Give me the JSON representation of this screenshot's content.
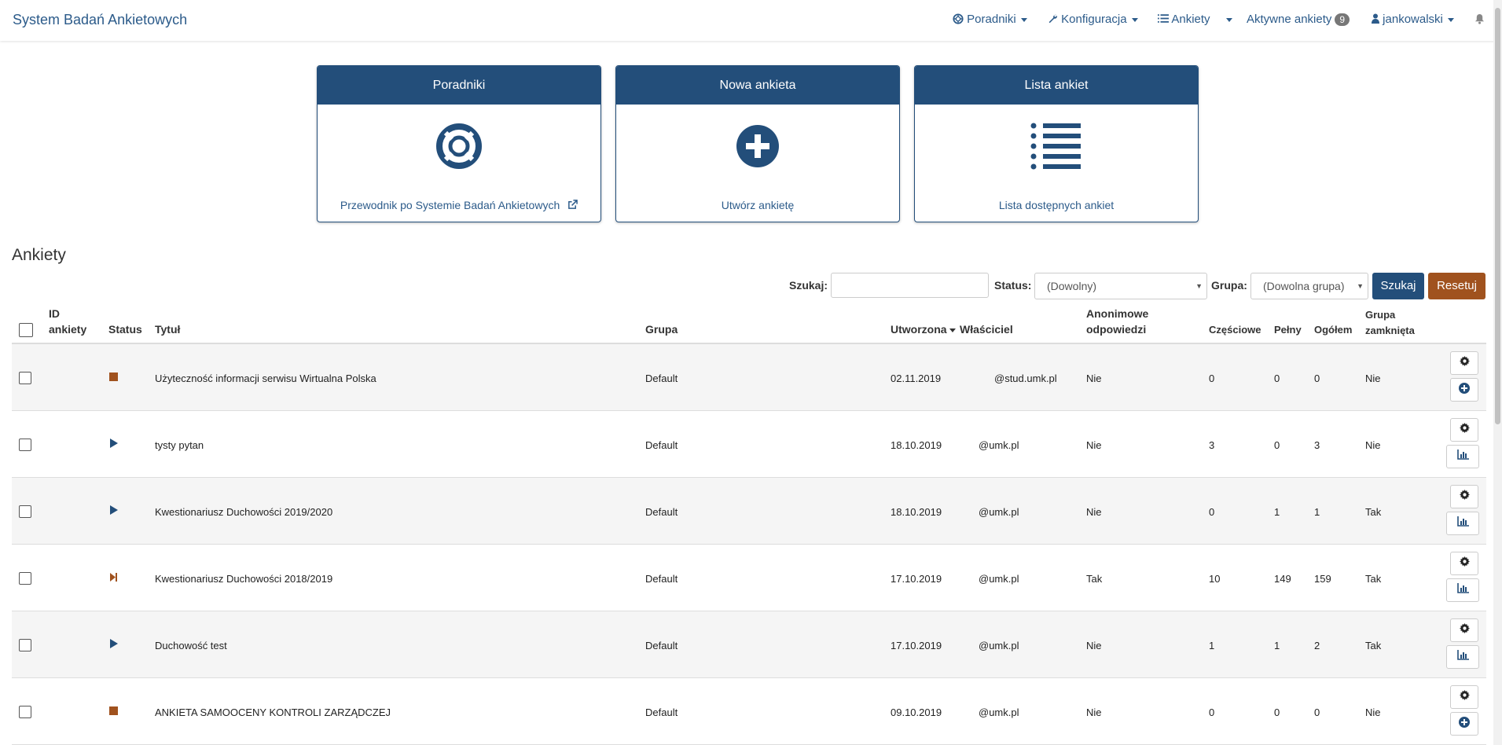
{
  "navbar": {
    "brand": "System Badań Ankietowych",
    "items": {
      "poradniki": "Poradniki",
      "konfiguracja": "Konfiguracja",
      "ankiety": "Ankiety",
      "aktywne": "Aktywne ankiety",
      "aktywne_count": "9",
      "user": "jankowalski"
    }
  },
  "cards": [
    {
      "title": "Poradniki",
      "icon": "lifebuoy-icon",
      "link": "Przewodnik po Systemie Badań Ankietowych"
    },
    {
      "title": "Nowa ankieta",
      "icon": "plus-circle-icon",
      "link": "Utwórz ankietę"
    },
    {
      "title": "Lista ankiet",
      "icon": "list-icon",
      "link": "Lista dostępnych ankiet"
    }
  ],
  "section_title": "Ankiety",
  "filters": {
    "search_label": "Szukaj:",
    "search_value": "",
    "status_label": "Status:",
    "status_value": "(Dowolny)",
    "group_label": "Grupa:",
    "group_value": "(Dowolna grupa)",
    "search_button": "Szukaj",
    "reset_button": "Resetuj"
  },
  "table": {
    "headers": {
      "id_line1": "ID",
      "id_line2": "ankiety",
      "status": "Status",
      "title": "Tytuł",
      "group": "Grupa",
      "created": "Utworzona",
      "owner": "Właściciel",
      "anon_line1": "Anonimowe",
      "anon_line2": "odpowiedzi",
      "partial": "Częściowe",
      "full": "Pełny",
      "total": "Ogółem",
      "closed_line1": "Grupa",
      "closed_line2": "zamknięta"
    },
    "rows": [
      {
        "status": "stopped",
        "title": "Użyteczność informacji serwisu Wirtualna Polska",
        "group": "Default",
        "created": "02.11.2019",
        "owner": "@stud.umk.pl",
        "anon": "Nie",
        "partial": "0",
        "full": "0",
        "total": "0",
        "closed": "Nie",
        "action": "add"
      },
      {
        "status": "active",
        "title": "tysty pytan",
        "group": "Default",
        "created": "18.10.2019",
        "owner": "@umk.pl",
        "anon": "Nie",
        "partial": "3",
        "full": "0",
        "total": "3",
        "closed": "Nie",
        "action": "stats"
      },
      {
        "status": "active",
        "title": "Kwestionariusz Duchowości 2019/2020",
        "group": "Default",
        "created": "18.10.2019",
        "owner": "@umk.pl",
        "anon": "Nie",
        "partial": "0",
        "full": "1",
        "total": "1",
        "closed": "Tak",
        "action": "stats"
      },
      {
        "status": "expired",
        "title": "Kwestionariusz Duchowości 2018/2019",
        "group": "Default",
        "created": "17.10.2019",
        "owner": "@umk.pl",
        "anon": "Tak",
        "partial": "10",
        "full": "149",
        "total": "159",
        "closed": "Tak",
        "action": "stats"
      },
      {
        "status": "active",
        "title": "Duchowość test",
        "group": "Default",
        "created": "17.10.2019",
        "owner": "@umk.pl",
        "anon": "Nie",
        "partial": "1",
        "full": "1",
        "total": "2",
        "closed": "Tak",
        "action": "stats"
      },
      {
        "status": "stopped",
        "title": "ANKIETA SAMOOCENY KONTROLI ZARZĄDCZEJ",
        "group": "Default",
        "created": "09.10.2019",
        "owner": "@umk.pl",
        "anon": "Nie",
        "partial": "0",
        "full": "0",
        "total": "0",
        "closed": "Nie",
        "action": "add"
      }
    ]
  },
  "colors": {
    "primary": "#234e7a",
    "link": "#2c5b8a",
    "reset": "#a0521e",
    "status_stopped": "#a0521e",
    "status_active": "#234e7a"
  }
}
